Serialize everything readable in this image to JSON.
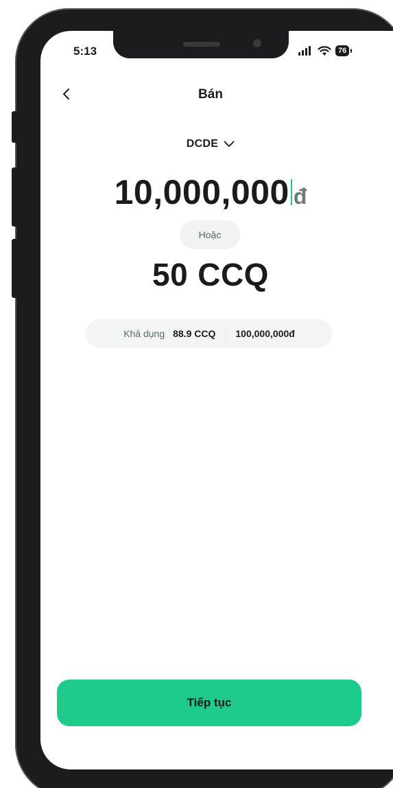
{
  "status_bar": {
    "time": "5:13",
    "battery": "76"
  },
  "header": {
    "title": "Bán"
  },
  "fund_selector": {
    "selected": "DCDE"
  },
  "amount": {
    "value": "10,000,000",
    "unit": "đ"
  },
  "separator": {
    "label": "Hoặc"
  },
  "units": {
    "value": "50",
    "unit": "CCQ"
  },
  "available": {
    "label": "Khả dụng",
    "ccq": "88.9 CCQ",
    "vnd": "100,000,000đ"
  },
  "footer": {
    "continue_label": "Tiếp tục"
  },
  "colors": {
    "accent": "#1fcb8a",
    "caret": "#1fc98a",
    "pill_bg": "#f2f5f3",
    "text": "#1b1b1b"
  }
}
